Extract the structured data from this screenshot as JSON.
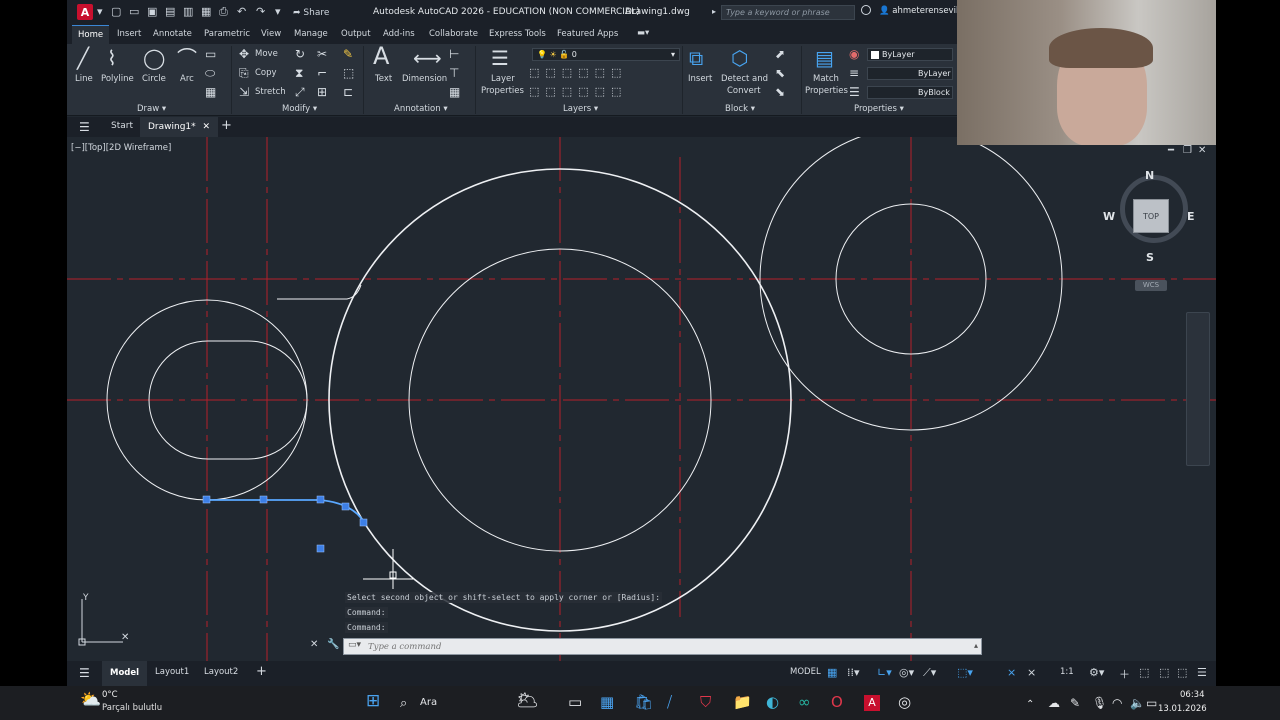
{
  "titlebar": {
    "app_icon": "A",
    "share_label": "Share",
    "title": "Autodesk AutoCAD 2026 - EDUCATION (NON COMMERCIAL)",
    "file": "Drawing1.dwg",
    "search_placeholder": "Type a keyword or phrase",
    "user": "ahmeterensevik"
  },
  "ribbon_tabs": [
    "Home",
    "Insert",
    "Annotate",
    "Parametric",
    "View",
    "Manage",
    "Output",
    "Add-ins",
    "Collaborate",
    "Express Tools",
    "Featured Apps"
  ],
  "ribbon": {
    "draw": {
      "line": "Line",
      "polyline": "Polyline",
      "circle": "Circle",
      "arc": "Arc",
      "panel": "Draw ▾"
    },
    "modify": {
      "move": "Move",
      "copy": "Copy",
      "stretch": "Stretch",
      "panel": "Modify ▾"
    },
    "annotation": {
      "text": "Text",
      "dimension": "Dimension",
      "panel": "Annotation ▾"
    },
    "layers": {
      "layer_props_1": "Layer",
      "layer_props_2": "Properties",
      "current_layer": "0",
      "panel": "Layers ▾"
    },
    "block": {
      "insert": "Insert",
      "detect_1": "Detect and",
      "detect_2": "Convert",
      "panel": "Block ▾"
    },
    "properties": {
      "match_1": "Match",
      "match_2": "Properties",
      "color": "ByLayer",
      "linetype": "ByLayer",
      "lineweight": "ByBlock",
      "panel": "Properties ▾"
    }
  },
  "doc_tabs": {
    "start": "Start",
    "drawing": "Drawing1*"
  },
  "viewport": {
    "label": "[−][Top][2D Wireframe]",
    "prompt": "Select second object or shift-select to apply corner or [Radius]:",
    "history_1": "Command:",
    "history_2": "Command:",
    "command_placeholder": "Type a command"
  },
  "viewcube": {
    "top": "TOP",
    "n": "N",
    "s": "S",
    "e": "E",
    "w": "W",
    "wcs": "WCS"
  },
  "status": {
    "tabs": [
      "Model",
      "Layout1",
      "Layout2"
    ],
    "model_label": "MODEL",
    "scale": "1:1"
  },
  "taskbar": {
    "temp": "0°C",
    "weather": "Parçalı bulutlu",
    "search": "Ara",
    "time": "06:34",
    "date": "13.01.2026"
  },
  "colors": {
    "accent": "#3b87d6",
    "canvas": "#212830",
    "centerline": "#c0202a"
  }
}
